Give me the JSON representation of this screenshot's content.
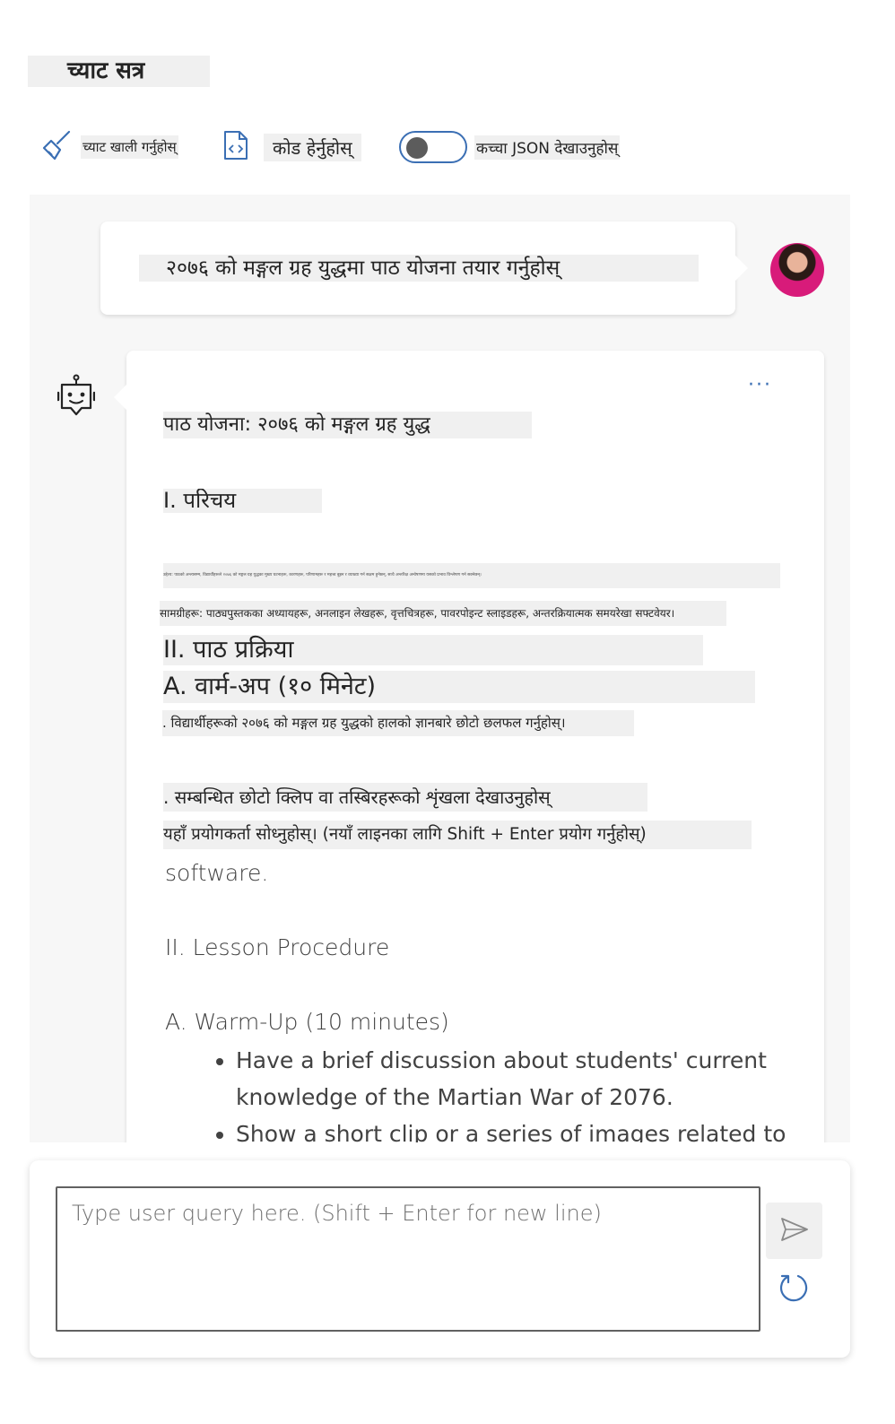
{
  "header": {
    "title": "च्याट सत्र"
  },
  "toolbar": {
    "clear_label": "च्याट खाली गर्नुहोस्",
    "code_label": "कोड हेर्नुहोस्",
    "json_label": "कच्चा JSON देखाउनुहोस्",
    "json_toggle_on": false
  },
  "chat": {
    "user_message": "२०७६ को मङ्गल ग्रह युद्धमा पाठ योजना तयार गर्नुहोस्",
    "bot_more_label": "···",
    "bot_lines": [
      "पाठ योजना: २०७६ को मङ्गल ग्रह युद्ध",
      "I. परिचय",
      "उद्देश्य: पाठको अन्त्यसम्म, विद्यार्थीहरूले २०७६ को मङ्गल ग्रह युद्धका मुख्य घटनाहरू, कारणहरू, परिणामहरू र महत्त्व बुझ्न र व्याख्या गर्न सक्षम हुनेछन्, साथै अन्तरिक्ष अन्वेषणमा यसको प्रभाव विश्लेषण गर्न सक्नेछन्।",
      "सामग्रीहरू: पाठ्यपुस्तकका अध्यायहरू, अनलाइन लेखहरू, वृत्तचित्रहरू, पावरपोइन्ट स्लाइडहरू, अन्तरक्रियात्मक समयरेखा सफ्टवेयर।",
      "II. पाठ प्रक्रिया",
      "A. वार्म-अप (१० मिनेट)",
      ". विद्यार्थीहरूको २०७६ को मङ्गल ग्रह युद्धको हालको ज्ञानबारे छोटो छलफल गर्नुहोस्।",
      ". सम्बन्धित छोटो क्लिप वा तस्बिरहरूको शृंखला देखाउनुहोस्",
      "यहाँ प्रयोगकर्ता सोध्नुहोस्। (नयाँ लाइनका लागि Shift + Enter प्रयोग गर्नुहोस्)"
    ],
    "english_lines": [
      "software.",
      "II. Lesson Procedure",
      "A. Warm-Up (10 minutes)"
    ],
    "bullets": [
      "Have a brief discussion about students' current knowledge of the Martian War of 2076.",
      "Show a short clip or a series of images related to"
    ]
  },
  "input": {
    "placeholder": "Type user query here. (Shift + Enter for new line)",
    "value": ""
  },
  "colors": {
    "accent": "#3b6fb4",
    "panel_bg": "#f7f7f7",
    "highlight_bg": "#f0f0f0"
  },
  "icons": {
    "clear": "broom-icon",
    "code": "code-file-icon",
    "bot": "bot-icon",
    "more": "more-icon",
    "send": "send-icon",
    "refresh": "refresh-icon"
  }
}
